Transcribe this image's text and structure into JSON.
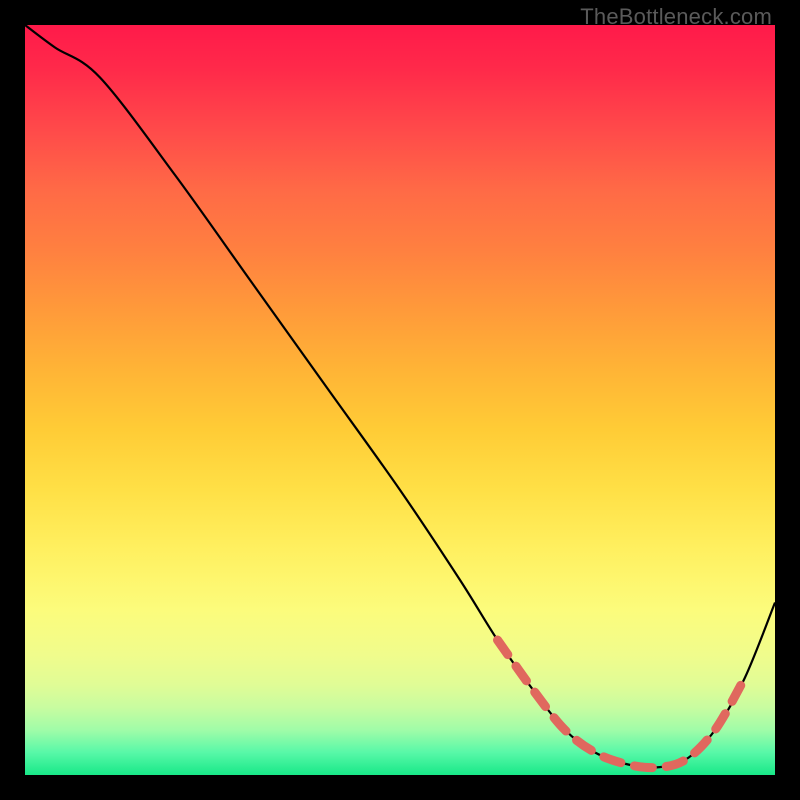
{
  "watermark": "TheBottleneck.com",
  "chart_data": {
    "type": "line",
    "title": "",
    "xlabel": "",
    "ylabel": "",
    "xlim": [
      0,
      100
    ],
    "ylim": [
      0,
      100
    ],
    "series": [
      {
        "name": "bottleneck-curve",
        "x": [
          0,
          4,
          10,
          20,
          30,
          40,
          50,
          58,
          63,
          68,
          72,
          76,
          80,
          84,
          88,
          92,
          96,
          100
        ],
        "y": [
          100,
          97,
          93,
          80,
          66,
          52,
          38,
          26,
          18,
          11,
          6,
          3,
          1.5,
          1,
          2,
          6,
          13,
          23
        ]
      }
    ],
    "highlight_range": {
      "name": "optimal-zone-dashes",
      "x_start": 63,
      "x_end": 96,
      "note": "dashed salmon segment along curve bottom"
    }
  }
}
